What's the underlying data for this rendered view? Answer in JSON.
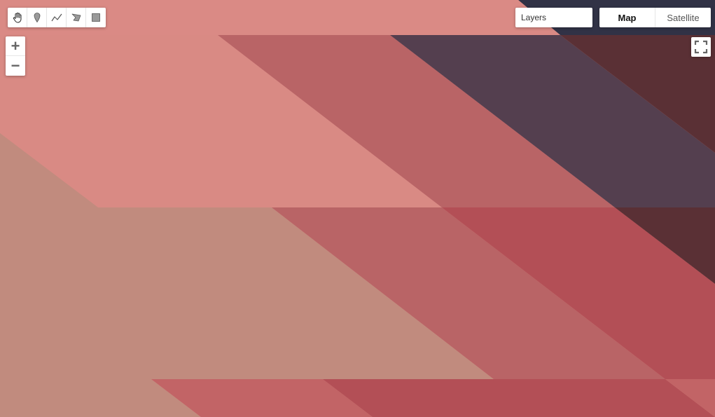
{
  "map": {
    "tile_colors": {
      "base": "#d98a84",
      "top_band": "#da8a85",
      "rose": "#b96466",
      "slate": "#543f4f",
      "maroon": "#5a3035",
      "tan": "#c18b7e",
      "crimson": "#b34f56",
      "coral": "#c26466",
      "navy": "#313246"
    }
  },
  "drawing_toolbar": {
    "tools": [
      {
        "name": "pan",
        "icon": "hand-icon"
      },
      {
        "name": "marker",
        "icon": "map-marker-icon"
      },
      {
        "name": "polyline",
        "icon": "polyline-icon"
      },
      {
        "name": "polygon",
        "icon": "polygon-icon"
      },
      {
        "name": "rectangle",
        "icon": "rectangle-icon"
      }
    ]
  },
  "zoom": {
    "in_label": "+",
    "out_label": "−"
  },
  "layers": {
    "label": "Layers"
  },
  "map_type": {
    "options": [
      "Map",
      "Satellite"
    ],
    "selected": "Map"
  },
  "fullscreen": {
    "icon": "fullscreen-icon"
  }
}
